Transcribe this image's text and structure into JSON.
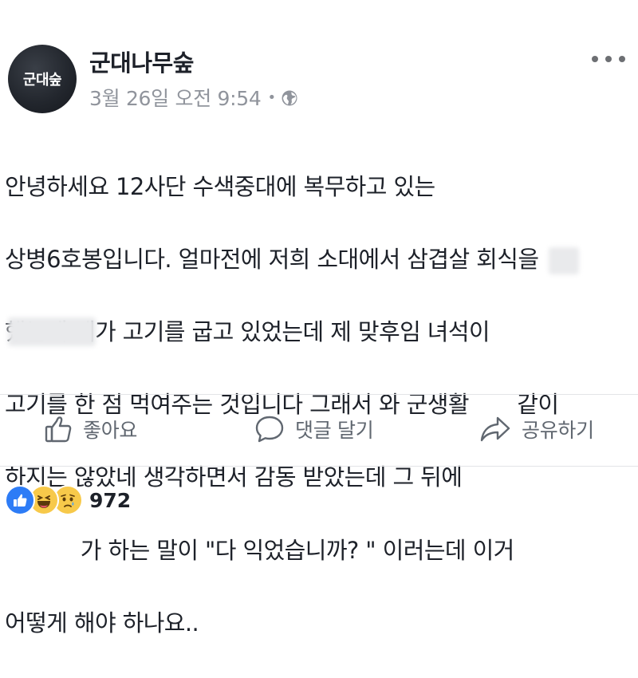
{
  "post": {
    "page_name": "군대나무숲",
    "avatar_label": "군대숲",
    "timestamp": "3월 26일 오전 9:54",
    "meta_separator": "•",
    "privacy_icon": "globe-icon",
    "more_icon": "more-horizontal-icon",
    "body_lines": [
      "안녕하세요 12사단 수색중대에 복무하고 있는",
      "상병6호봉입니다. 얼마전에 저희 소대에서 삼겹살 회식을",
      "했는데 제가 고기를 굽고 있었는데 제 맞후임 녀석이",
      "고기를 한 점 먹여주는 것입니다 그래서 와 군생활       같이",
      "하지는 않았네 생각하면서 감동 받았는데 그 뒤에",
      "           가 하는 말이 \"다 익었습니까? \" 이러는데 이거",
      "어떻게 해야 하나요.."
    ]
  },
  "actions": {
    "like_label": "좋아요",
    "comment_label": "댓글 달기",
    "share_label": "공유하기"
  },
  "reactions": {
    "types": [
      "like",
      "haha",
      "sad"
    ],
    "count": "972"
  },
  "colors": {
    "text": "#1d2129",
    "meta": "#90949c",
    "action": "#606770",
    "like_blue": "#2d7cf6",
    "emoji_yellow": "#f7c94a",
    "divider": "#e3e4e7"
  }
}
